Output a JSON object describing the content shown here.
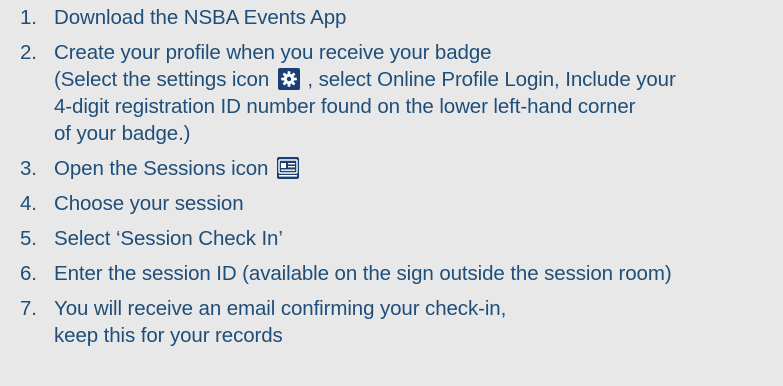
{
  "steps": [
    {
      "number": "1.",
      "lines": [
        "Download the NSBA Events App"
      ]
    },
    {
      "number": "2.",
      "lines": [
        "Create your profile when you receive your badge",
        "(Select the settings icon",
        ", select Online Profile Login, Include your",
        "4-digit registration ID number found on the lower left-hand corner",
        "of your badge.)"
      ],
      "icon": "gear-icon"
    },
    {
      "number": "3.",
      "lines": [
        "Open the Sessions icon"
      ],
      "icon": "sessions-icon"
    },
    {
      "number": "4.",
      "lines": [
        "Choose your session"
      ]
    },
    {
      "number": "5.",
      "lines": [
        "Select ‘Session Check In’"
      ]
    },
    {
      "number": "6.",
      "lines": [
        "Enter the session ID (available on the sign outside the session room)"
      ]
    },
    {
      "number": "7.",
      "lines": [
        "You will receive an email confirming your check-in,",
        "keep this for your records"
      ]
    }
  ],
  "colors": {
    "text": "#1f4e79",
    "background": "#e8e8e8",
    "icon_background": "#1b3f73",
    "icon_foreground": "#ffffff"
  }
}
